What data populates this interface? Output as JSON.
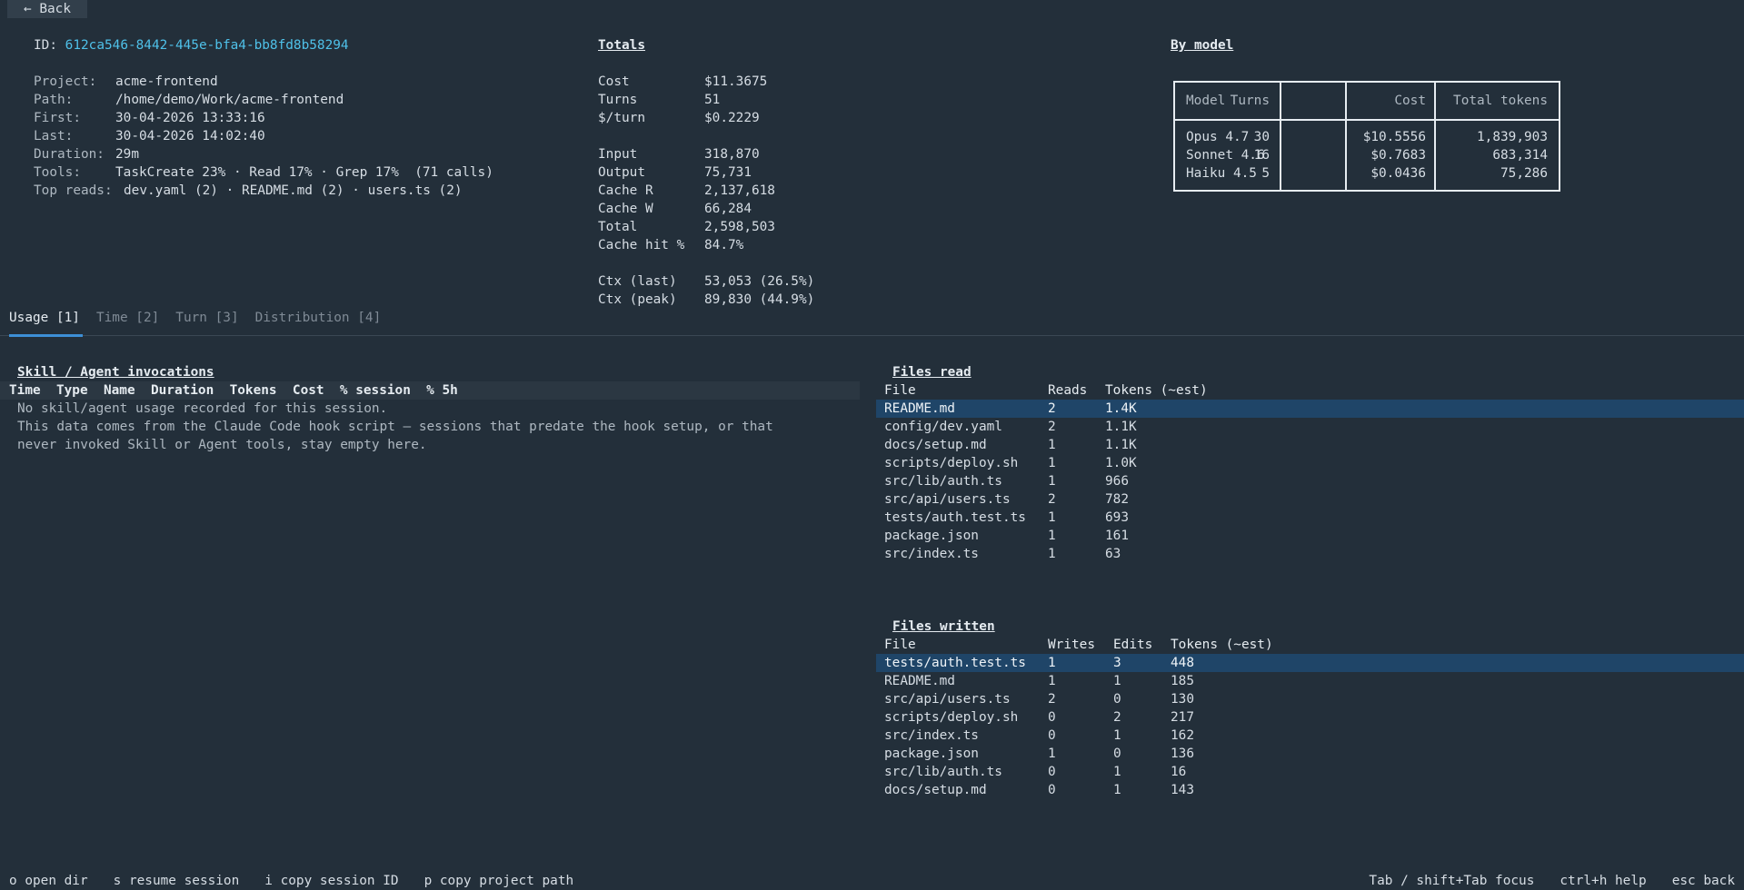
{
  "back_label": "← Back",
  "session": {
    "id_label": "ID:",
    "id": "612ca546-8442-445e-bfa4-bb8fd8b58294",
    "project_label": "Project:",
    "project": "acme-frontend",
    "path_label": "Path:",
    "path": "/home/demo/Work/acme-frontend",
    "first_label": "First:",
    "first": "30-04-2026 13:33:16",
    "last_label": "Last:",
    "last": "30-04-2026 14:02:40",
    "duration_label": "Duration:",
    "duration": "29m",
    "tools_label": "Tools:",
    "tools": "TaskCreate 23% · Read 17% · Grep 17%  (71 calls)",
    "top_reads_label": "Top reads:",
    "top_reads": "dev.yaml (2) · README.md (2) · users.ts (2)"
  },
  "totals": {
    "heading": "Totals",
    "cost_label": "Cost",
    "cost": "$11.3675",
    "turns_label": "Turns",
    "turns": "51",
    "per_turn_label": "$/turn",
    "per_turn": "$0.2229",
    "input_label": "Input",
    "input": "318,870",
    "output_label": "Output",
    "output": "75,731",
    "cache_r_label": "Cache R",
    "cache_r": "2,137,618",
    "cache_w_label": "Cache W",
    "cache_w": "66,284",
    "total_label": "Total",
    "total": "2,598,503",
    "cache_hit_label": "Cache hit %",
    "cache_hit": "84.7%",
    "ctx_last_label": "Ctx (last)",
    "ctx_last": "53,053 (26.5%)",
    "ctx_peak_label": "Ctx (peak)",
    "ctx_peak": "89,830 (44.9%)"
  },
  "by_model": {
    "heading": "By model",
    "headers": {
      "model": "Model",
      "turns": "Turns",
      "cost": "Cost",
      "tokens": "Total tokens"
    },
    "rows": [
      {
        "model": "Opus 4.7",
        "turns": "30",
        "cost": "$10.5556",
        "tokens": "1,839,903"
      },
      {
        "model": "Sonnet 4.6",
        "turns": "16",
        "cost": "$0.7683",
        "tokens": "683,314"
      },
      {
        "model": "Haiku 4.5",
        "turns": "5",
        "cost": "$0.0436",
        "tokens": "75,286"
      }
    ]
  },
  "tabs": [
    {
      "label": "Usage [1]"
    },
    {
      "label": "Time [2]"
    },
    {
      "label": "Turn [3]"
    },
    {
      "label": "Distribution [4]"
    }
  ],
  "skills": {
    "heading": "Skill / Agent invocations",
    "columns": "Time  Type  Name  Duration  Tokens  Cost  % session  % 5h",
    "empty_line1": "No skill/agent usage recorded for this session.",
    "empty_line2": "This data comes from the Claude Code hook script — sessions that predate the hook setup, or that",
    "empty_line3": "never invoked Skill or Agent tools, stay empty here."
  },
  "files_read": {
    "heading": "Files read",
    "headers": {
      "file": "File",
      "reads": "Reads",
      "tokens": "Tokens (~est)"
    },
    "rows": [
      {
        "file": "README.md",
        "reads": "2",
        "tokens": "1.4K"
      },
      {
        "file": "config/dev.yaml",
        "reads": "2",
        "tokens": "1.1K"
      },
      {
        "file": "docs/setup.md",
        "reads": "1",
        "tokens": "1.1K"
      },
      {
        "file": "scripts/deploy.sh",
        "reads": "1",
        "tokens": "1.0K"
      },
      {
        "file": "src/lib/auth.ts",
        "reads": "1",
        "tokens": "966"
      },
      {
        "file": "src/api/users.ts",
        "reads": "2",
        "tokens": "782"
      },
      {
        "file": "tests/auth.test.ts",
        "reads": "1",
        "tokens": "693"
      },
      {
        "file": "package.json",
        "reads": "1",
        "tokens": "161"
      },
      {
        "file": "src/index.ts",
        "reads": "1",
        "tokens": "63"
      }
    ]
  },
  "files_written": {
    "heading": "Files written",
    "headers": {
      "file": "File",
      "writes": "Writes",
      "edits": "Edits",
      "tokens": "Tokens (~est)"
    },
    "rows": [
      {
        "file": "tests/auth.test.ts",
        "writes": "1",
        "edits": "3",
        "tokens": "448"
      },
      {
        "file": "README.md",
        "writes": "1",
        "edits": "1",
        "tokens": "185"
      },
      {
        "file": "src/api/users.ts",
        "writes": "2",
        "edits": "0",
        "tokens": "130"
      },
      {
        "file": "scripts/deploy.sh",
        "writes": "0",
        "edits": "2",
        "tokens": "217"
      },
      {
        "file": "src/index.ts",
        "writes": "0",
        "edits": "1",
        "tokens": "162"
      },
      {
        "file": "package.json",
        "writes": "1",
        "edits": "0",
        "tokens": "136"
      },
      {
        "file": "src/lib/auth.ts",
        "writes": "0",
        "edits": "1",
        "tokens": "16"
      },
      {
        "file": "docs/setup.md",
        "writes": "0",
        "edits": "1",
        "tokens": "143"
      }
    ]
  },
  "footer": {
    "left": [
      "o open dir",
      "s resume session",
      "i copy session ID",
      "p copy project path"
    ],
    "right": [
      "Tab / shift+Tab focus",
      "ctrl+h help",
      "esc back"
    ]
  },
  "colors": {
    "background": "#232f3a",
    "accent": "#3d8fd6",
    "id": "#4fc1e9",
    "selected_row": "#1f4568"
  }
}
